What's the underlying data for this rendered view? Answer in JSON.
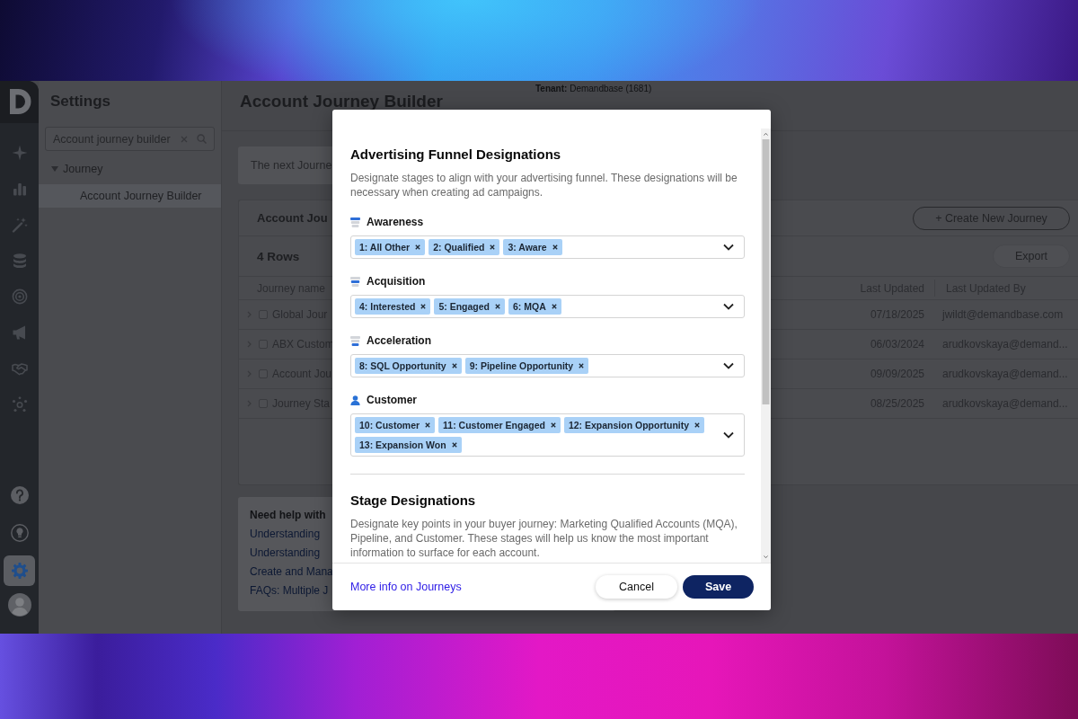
{
  "nav_rail": {
    "top_items": [
      {
        "selected": false
      },
      {
        "selected": false
      },
      {
        "selected": false
      },
      {
        "selected": false
      },
      {
        "selected": false
      },
      {
        "selected": false
      },
      {
        "selected": false
      },
      {
        "selected": false
      }
    ],
    "bottom_items": [
      {
        "selected": false
      },
      {
        "selected": false
      },
      {
        "selected": true
      }
    ]
  },
  "settings_panel": {
    "title": "Settings",
    "search": {
      "value": "Account journey builder"
    },
    "tree": [
      {
        "label": "Journey",
        "expanded": true,
        "selected": false,
        "children": [
          {
            "label": "Account Journey Builder",
            "selected": true
          }
        ]
      }
    ]
  },
  "header": {
    "tenant": "**Tenant:** Demandbase (1681)",
    "title": "Account Journey Builder"
  },
  "banner": {
    "text": "The next Journe"
  },
  "journeys_card": {
    "title": "Account Jou",
    "create_button": "+ Create New Journey",
    "row_count": "4 Rows",
    "export_button": "Export",
    "table": {
      "columns": [
        "Journey name",
        "Last Updated",
        "Last Updated By"
      ],
      "rows": [
        {
          "expanded": false,
          "checked": false,
          "cells": [
            "Global Jour",
            "07/18/2025",
            "jwildt@demandbase.com"
          ]
        },
        {
          "expanded": false,
          "checked": false,
          "cells": [
            "ABX Custom",
            "06/03/2024",
            "arudkovskaya@demand..."
          ]
        },
        {
          "expanded": false,
          "checked": false,
          "cells": [
            "Account Jou",
            "09/09/2025",
            "arudkovskaya@demand..."
          ]
        },
        {
          "expanded": false,
          "checked": false,
          "cells": [
            "Journey Sta",
            "08/25/2025",
            "arudkovskaya@demand..."
          ]
        }
      ]
    }
  },
  "help": {
    "title": "Need help with",
    "links": [
      "Understanding",
      "Understanding",
      "Create and Mana",
      "FAQs: Multiple J"
    ]
  },
  "modal": {
    "sections": [
      {
        "title": "Advertising Funnel Designations",
        "description": "Designate stages to align with your advertising funnel. These designations will be necessary when creating ad campaigns.",
        "stages": [
          {
            "kind": "top",
            "label": "Awareness",
            "tags": [
              "1: All Other",
              "2: Qualified",
              "3: Aware"
            ]
          },
          {
            "kind": "middle",
            "label": "Acquisition",
            "tags": [
              "4: Interested",
              "5: Engaged",
              "6: MQA"
            ]
          },
          {
            "kind": "bottom",
            "label": "Acceleration",
            "tags": [
              "8: SQL Opportunity",
              "9: Pipeline Opportunity"
            ]
          },
          {
            "kind": "person",
            "label": "Customer",
            "tags": [
              "10: Customer",
              "11: Customer Engaged",
              "12: Expansion Opportunity",
              "13: Expansion Won"
            ]
          }
        ]
      },
      {
        "title": "Stage Designations",
        "description": "Designate key points in your buyer journey: Marketing Qualified Accounts (MQA), Pipeline, and Customer. These stages will help us know the most important information to surface for each account."
      }
    ],
    "footer_link": "More info on Journeys",
    "buttons": [
      {
        "label": "Cancel",
        "kind": "cancel"
      },
      {
        "label": "Save",
        "kind": "save"
      }
    ]
  }
}
